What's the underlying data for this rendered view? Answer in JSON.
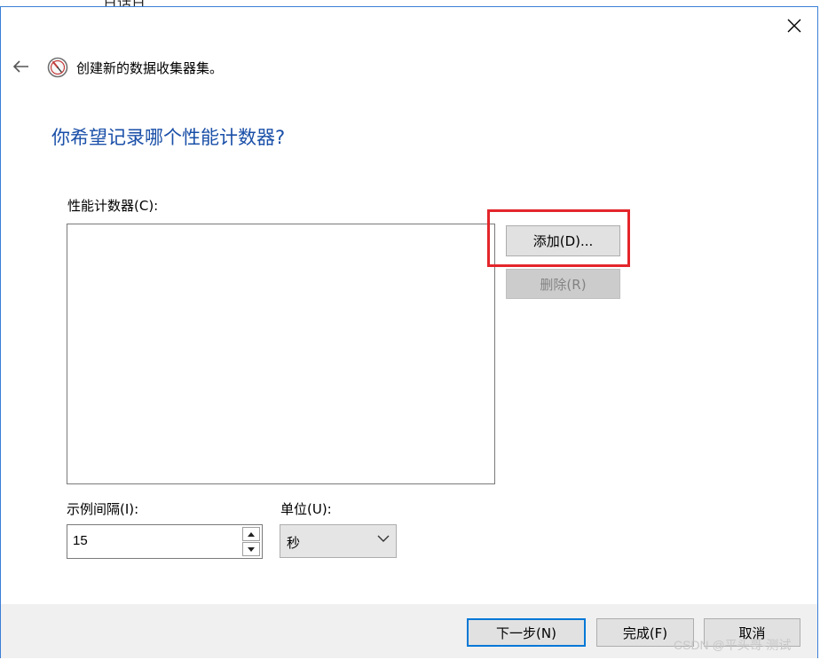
{
  "top_peek_text": "日话日",
  "wizard": {
    "title": "创建新的数据收集器集。",
    "heading": "你希望记录哪个性能计数器?"
  },
  "counters": {
    "label": "性能计数器(C):",
    "items": [],
    "add_label": "添加(D)...",
    "delete_label": "删除(R)"
  },
  "interval": {
    "label": "示例间隔(I):",
    "value": "15"
  },
  "unit": {
    "label": "单位(U):",
    "selected": "秒"
  },
  "footer": {
    "next_label": "下一步(N)",
    "finish_label": "完成(F)",
    "cancel_label": "取消"
  },
  "watermark": "CSDN @平头哥-测试",
  "icons": {
    "close": "close-icon",
    "back": "back-arrow-icon",
    "wizard": "performance-monitor-icon",
    "spin_up": "spin-up-icon",
    "spin_down": "spin-down-icon",
    "dropdown": "chevron-down-icon"
  },
  "colors": {
    "heading": "#1a4fa8",
    "highlight": "#e3262b",
    "default_button_border": "#0078d7",
    "footer_bg": "#f0f0f0"
  }
}
